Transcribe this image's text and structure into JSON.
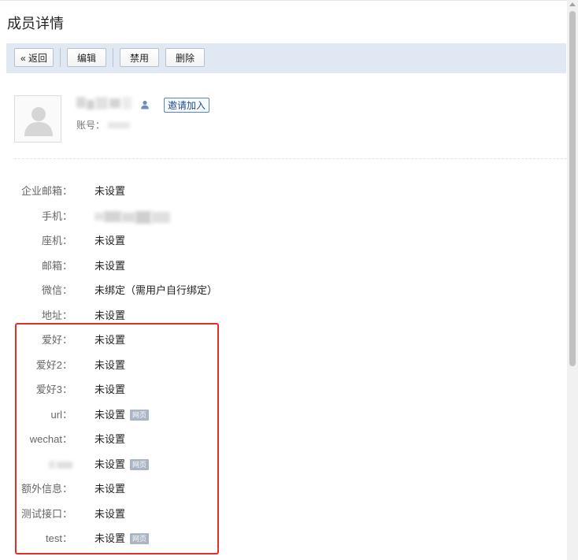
{
  "page_title": "成员详情",
  "toolbar": {
    "back_label": "« 返回",
    "edit_label": "编辑",
    "disable_label": "禁用",
    "delete_label": "删除"
  },
  "profile": {
    "invite_label": "邀请加入",
    "account_label": "账号："
  },
  "fields": [
    {
      "label": "企业邮箱：",
      "value": "未设置"
    },
    {
      "label": "手机：",
      "value": ""
    },
    {
      "label": "座机：",
      "value": "未设置"
    },
    {
      "label": "邮箱：",
      "value": "未设置"
    },
    {
      "label": "微信：",
      "value": "未绑定（需用户自行绑定）"
    },
    {
      "label": "地址：",
      "value": "未设置"
    },
    {
      "label": "爱好：",
      "value": "未设置"
    },
    {
      "label": "爱好2：",
      "value": "未设置"
    },
    {
      "label": "爱好3：",
      "value": "未设置"
    },
    {
      "label": "url：",
      "value": "未设置",
      "tag": "网页"
    },
    {
      "label": "wechat：",
      "value": "未设置"
    },
    {
      "label": "",
      "value": "未设置",
      "tag": "网页"
    },
    {
      "label": "额外信息：",
      "value": "未设置"
    },
    {
      "label": "测试接口：",
      "value": "未设置"
    },
    {
      "label": "test：",
      "value": "未设置",
      "tag": "网页"
    }
  ],
  "colors": {
    "toolbar_bg": "#dfe8f3",
    "highlight_border": "#e0302b",
    "tag_bg": "#a9b5c4",
    "invite_border": "#5b86b6"
  },
  "icons": {
    "avatar": "default-avatar-icon",
    "person": "person-icon"
  }
}
